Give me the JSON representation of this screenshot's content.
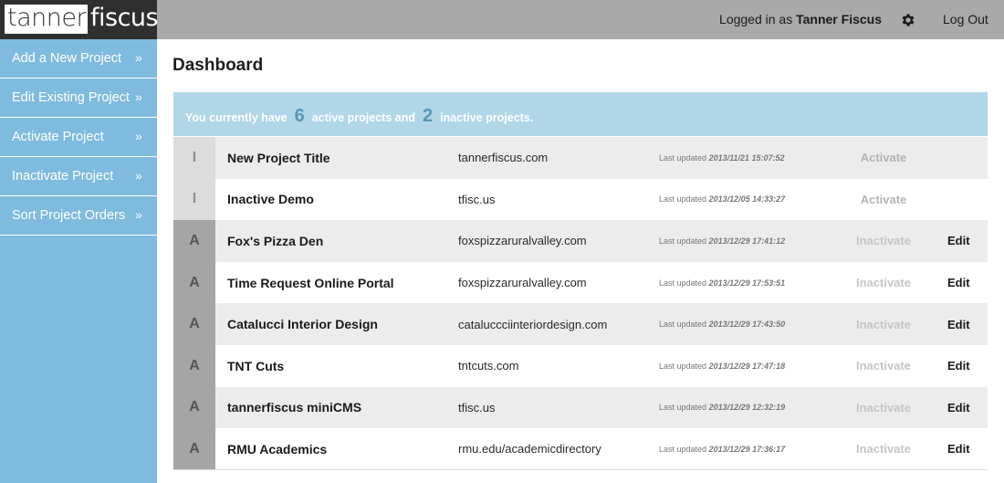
{
  "header": {
    "logo_part1": "tanner",
    "logo_part2": "fiscus",
    "logged_in_prefix": "Logged in as",
    "user_name": "Tanner Fiscus",
    "settings_icon": "gear-icon",
    "logout_label": "Log Out"
  },
  "sidebar": {
    "items": [
      {
        "label": "Add a New Project"
      },
      {
        "label": "Edit Existing Project"
      },
      {
        "label": "Activate Project"
      },
      {
        "label": "Inactivate Project"
      },
      {
        "label": "Sort Project Orders"
      }
    ],
    "chevron": "»"
  },
  "main": {
    "title": "Dashboard",
    "summary": {
      "prefix": "You currently have",
      "active_count": "6",
      "middle": "active projects and",
      "inactive_count": "2",
      "suffix": "inactive projects."
    },
    "last_updated_label": "Last updated",
    "projects": [
      {
        "status": "I",
        "title": "New Project Title",
        "domain": "tannerfiscus.com",
        "updated": "2013/11/21 15:07:52",
        "action": "Activate",
        "edit": ""
      },
      {
        "status": "I",
        "title": "Inactive Demo",
        "domain": "tfisc.us",
        "updated": "2013/12/05 14:33:27",
        "action": "Activate",
        "edit": ""
      },
      {
        "status": "A",
        "title": "Fox's Pizza Den",
        "domain": "foxspizzaruralvalley.com",
        "updated": "2013/12/29 17:41:12",
        "action": "Inactivate",
        "edit": "Edit"
      },
      {
        "status": "A",
        "title": "Time Request Online Portal",
        "domain": "foxspizzaruralvalley.com",
        "updated": "2013/12/29 17:53:51",
        "action": "Inactivate",
        "edit": "Edit"
      },
      {
        "status": "A",
        "title": "Catalucci Interior Design",
        "domain": "cataluccciinteriordesign.com",
        "updated": "2013/12/29 17:43:50",
        "action": "Inactivate",
        "edit": "Edit"
      },
      {
        "status": "A",
        "title": "TNT Cuts",
        "domain": "tntcuts.com",
        "updated": "2013/12/29 17:47:18",
        "action": "Inactivate",
        "edit": "Edit"
      },
      {
        "status": "A",
        "title": "tannerfiscus miniCMS",
        "domain": "tfisc.us",
        "updated": "2013/12/29 12:32:19",
        "action": "Inactivate",
        "edit": "Edit"
      },
      {
        "status": "A",
        "title": "RMU Academics",
        "domain": "rmu.edu/academicdirectory",
        "updated": "2013/12/29 17:36:17",
        "action": "Inactivate",
        "edit": "Edit"
      }
    ]
  },
  "colors": {
    "header_bg": "#a9a9a9",
    "sidebar_bg": "#7fbbdf",
    "summary_bg": "#b1d6e8",
    "summary_number": "#5b95b4"
  }
}
